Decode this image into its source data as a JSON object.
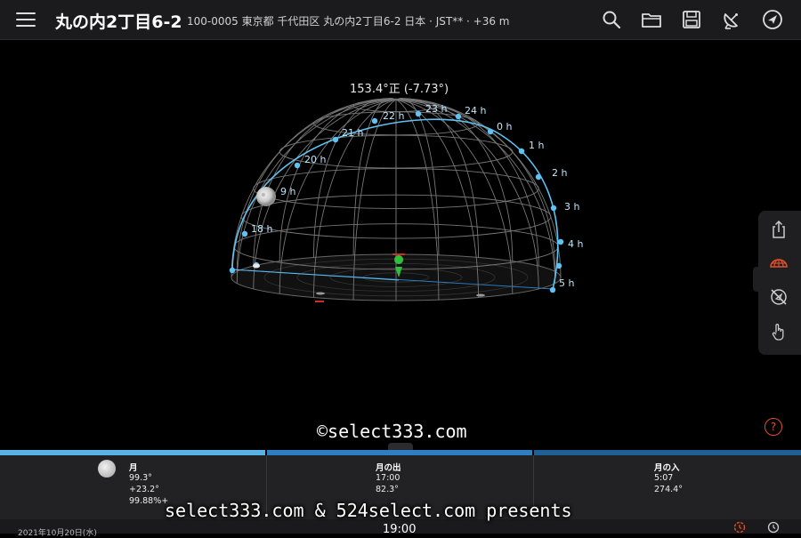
{
  "header": {
    "title": "丸の内2丁目6-2",
    "address": "100-0005 東京都 千代田区 丸の内2丁目6-2 日本 · JST** · +36 m",
    "icons": [
      "menu-icon",
      "search-icon",
      "folder-icon",
      "save-icon",
      "satellite-dish-icon",
      "compass-icon"
    ]
  },
  "view": {
    "azimuth_readout": "153.4°正 (-7.73°)",
    "hour_labels": [
      "18 h",
      "9 h",
      "20 h",
      "21 h",
      "22 h",
      "23 h",
      "24 h",
      "0 h",
      "1 h",
      "2 h",
      "3 h",
      "4 h",
      "5 h"
    ]
  },
  "sidebar": {
    "icons": [
      "share-icon",
      "dome-icon",
      "no-compass-icon",
      "hand-icon"
    ]
  },
  "panel": {
    "moon": {
      "label": "月",
      "values": [
        "99.3°",
        "+23.2°",
        "99.88%+"
      ]
    },
    "moonrise": {
      "label": "月の出",
      "values": [
        "17:00",
        "82.3°"
      ]
    },
    "moonset": {
      "label": "月の入",
      "values": [
        "5:07",
        "274.4°"
      ]
    }
  },
  "footer": {
    "date": "2021年10月20日(水)",
    "time": "19:00"
  },
  "watermarks": {
    "center": "©select333.com",
    "bottom": "select333.com & 524select.com presents"
  },
  "colors": {
    "path": "#5fc2f0",
    "accent_orange": "#e0502a",
    "bar_left": "#58b4e6",
    "bar_mid": "#2d7fc4",
    "bar_right": "#1e5f96"
  }
}
